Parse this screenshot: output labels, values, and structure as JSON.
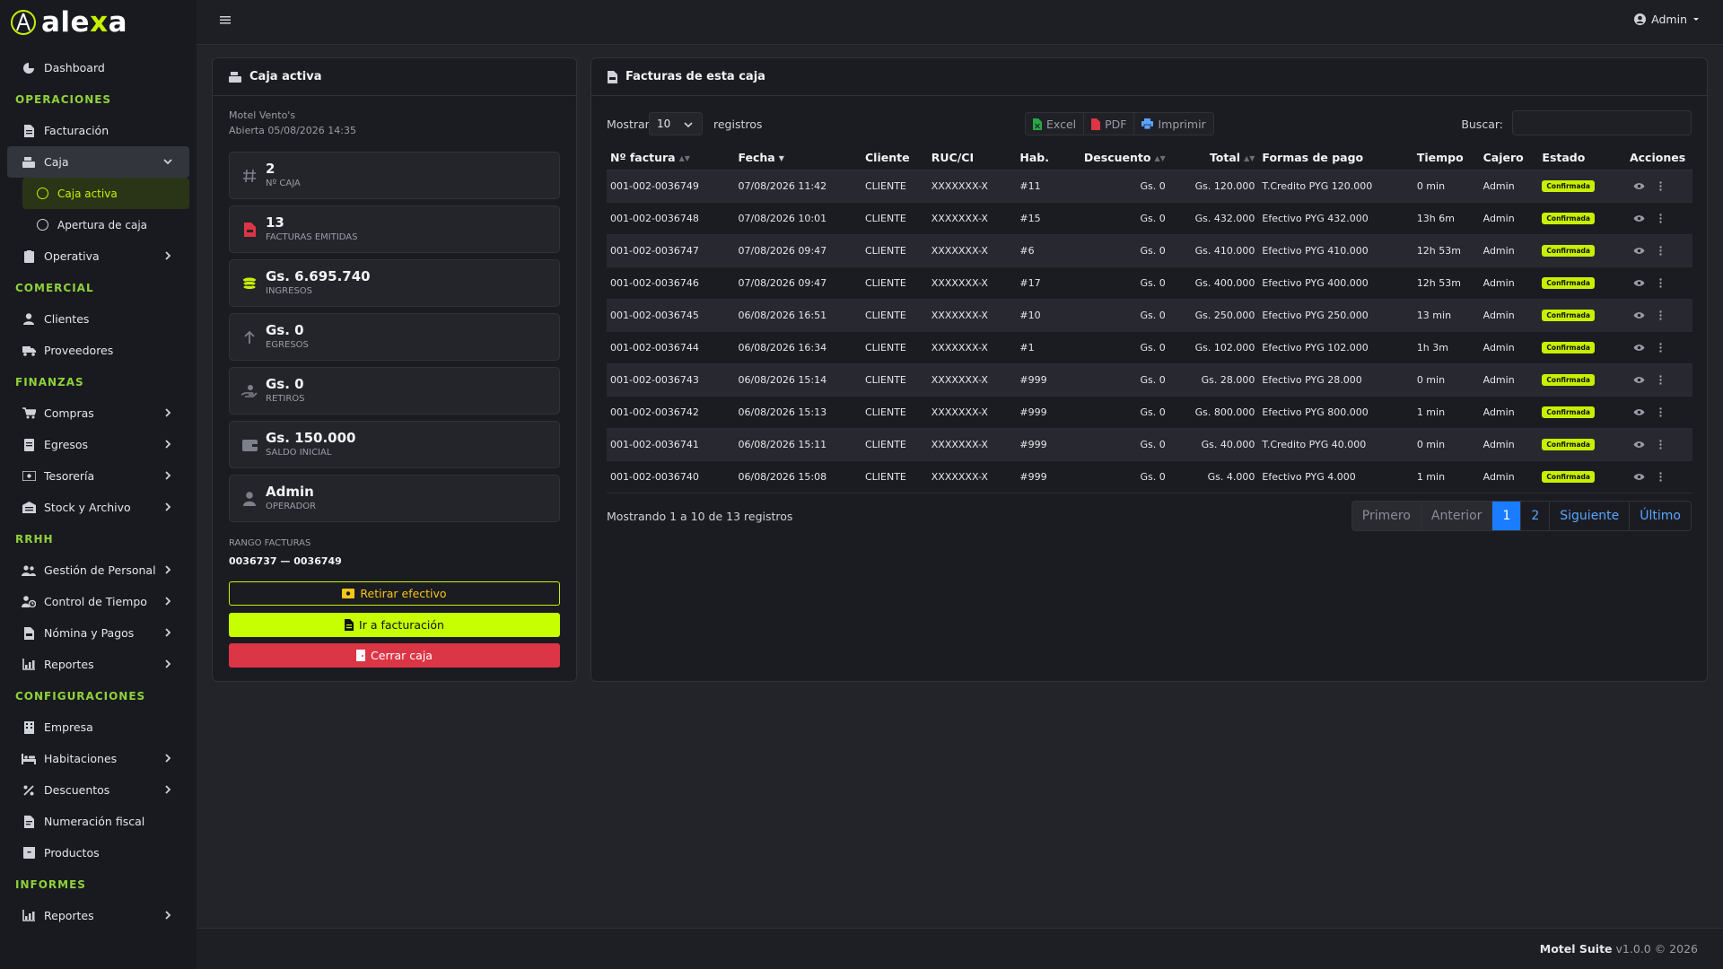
{
  "brand": {
    "name_pre": "ale",
    "name_x": "x",
    "name_post": "a"
  },
  "sidebar": {
    "dashboard": "Dashboard",
    "sections": {
      "operaciones": "OPERACIONES",
      "comercial": "COMERCIAL",
      "finanzas": "FINANZAS",
      "rrhh": "RRHH",
      "configuraciones": "CONFIGURACIONES",
      "informes": "INFORMES"
    },
    "items": {
      "facturacion": "Facturación",
      "caja": "Caja",
      "caja_activa": "Caja activa",
      "apertura_caja": "Apertura de caja",
      "operativa": "Operativa",
      "clientes": "Clientes",
      "proveedores": "Proveedores",
      "compras": "Compras",
      "egresos": "Egresos",
      "tesoreria": "Tesorería",
      "stock": "Stock y Archivo",
      "personal": "Gestión de Personal",
      "tiempo": "Control de Tiempo",
      "nomina": "Nómina y Pagos",
      "reportes_rrhh": "Reportes",
      "empresa": "Empresa",
      "habitaciones": "Habitaciones",
      "descuentos": "Descuentos",
      "numeracion": "Numeración fiscal",
      "productos": "Productos",
      "reportes_informes": "Reportes"
    }
  },
  "topbar": {
    "user": "Admin"
  },
  "caja": {
    "title": "Caja activa",
    "motel": "Motel Vento's",
    "opened": "Abierta 05/08/2026 14:35",
    "stats": {
      "numero": {
        "value": "2",
        "label": "Nº CAJA"
      },
      "facturas": {
        "value": "13",
        "label": "FACTURAS EMITIDAS"
      },
      "ingresos": {
        "value": "Gs. 6.695.740",
        "label": "INGRESOS"
      },
      "egresos": {
        "value": "Gs. 0",
        "label": "EGRESOS"
      },
      "retiros": {
        "value": "Gs. 0",
        "label": "RETIROS"
      },
      "saldo": {
        "value": "Gs. 150.000",
        "label": "SALDO INICIAL"
      },
      "operador": {
        "value": "Admin",
        "label": "OPERADOR"
      }
    },
    "range_label": "RANGO FACTURAS",
    "range_value": "0036737 — 0036749",
    "btn_retirar": "Retirar efectivo",
    "btn_facturacion": "Ir a facturación",
    "btn_cerrar": "Cerrar caja"
  },
  "facturas": {
    "title": "Facturas de esta caja",
    "show_label": "Mostrar",
    "show_value": "10",
    "records_label": "registros",
    "export": {
      "excel": "Excel",
      "pdf": "PDF",
      "print": "Imprimir"
    },
    "search_label": "Buscar:",
    "search_value": "",
    "columns": [
      "Nº factura",
      "Fecha",
      "Cliente",
      "RUC/CI",
      "Hab.",
      "Descuento",
      "Total",
      "Formas de pago",
      "Tiempo",
      "Cajero",
      "Estado",
      "Acciones"
    ],
    "rows": [
      {
        "num": "001-002-0036749",
        "fecha": "07/08/2026 11:42",
        "cliente": "CLIENTE",
        "ruc": "XXXXXXX-X",
        "hab": "#11",
        "desc": "Gs. 0",
        "total": "Gs. 120.000",
        "pago": "T.Credito PYG 120.000",
        "tiempo": "0 min",
        "cajero": "Admin",
        "estado": "Confirmada"
      },
      {
        "num": "001-002-0036748",
        "fecha": "07/08/2026 10:01",
        "cliente": "CLIENTE",
        "ruc": "XXXXXXX-X",
        "hab": "#15",
        "desc": "Gs. 0",
        "total": "Gs. 432.000",
        "pago": "Efectivo PYG 432.000",
        "tiempo": "13h 6m",
        "cajero": "Admin",
        "estado": "Confirmada"
      },
      {
        "num": "001-002-0036747",
        "fecha": "07/08/2026 09:47",
        "cliente": "CLIENTE",
        "ruc": "XXXXXXX-X",
        "hab": "#6",
        "desc": "Gs. 0",
        "total": "Gs. 410.000",
        "pago": "Efectivo PYG 410.000",
        "tiempo": "12h 53m",
        "cajero": "Admin",
        "estado": "Confirmada"
      },
      {
        "num": "001-002-0036746",
        "fecha": "07/08/2026 09:47",
        "cliente": "CLIENTE",
        "ruc": "XXXXXXX-X",
        "hab": "#17",
        "desc": "Gs. 0",
        "total": "Gs. 400.000",
        "pago": "Efectivo PYG 400.000",
        "tiempo": "12h 53m",
        "cajero": "Admin",
        "estado": "Confirmada"
      },
      {
        "num": "001-002-0036745",
        "fecha": "06/08/2026 16:51",
        "cliente": "CLIENTE",
        "ruc": "XXXXXXX-X",
        "hab": "#10",
        "desc": "Gs. 0",
        "total": "Gs. 250.000",
        "pago": "Efectivo PYG 250.000",
        "tiempo": "13 min",
        "cajero": "Admin",
        "estado": "Confirmada"
      },
      {
        "num": "001-002-0036744",
        "fecha": "06/08/2026 16:34",
        "cliente": "CLIENTE",
        "ruc": "XXXXXXX-X",
        "hab": "#1",
        "desc": "Gs. 0",
        "total": "Gs. 102.000",
        "pago": "Efectivo PYG 102.000",
        "tiempo": "1h 3m",
        "cajero": "Admin",
        "estado": "Confirmada"
      },
      {
        "num": "001-002-0036743",
        "fecha": "06/08/2026 15:14",
        "cliente": "CLIENTE",
        "ruc": "XXXXXXX-X",
        "hab": "#999",
        "desc": "Gs. 0",
        "total": "Gs. 28.000",
        "pago": "Efectivo PYG 28.000",
        "tiempo": "0 min",
        "cajero": "Admin",
        "estado": "Confirmada"
      },
      {
        "num": "001-002-0036742",
        "fecha": "06/08/2026 15:13",
        "cliente": "CLIENTE",
        "ruc": "XXXXXXX-X",
        "hab": "#999",
        "desc": "Gs. 0",
        "total": "Gs. 800.000",
        "pago": "Efectivo PYG 800.000",
        "tiempo": "1 min",
        "cajero": "Admin",
        "estado": "Confirmada"
      },
      {
        "num": "001-002-0036741",
        "fecha": "06/08/2026 15:11",
        "cliente": "CLIENTE",
        "ruc": "XXXXXXX-X",
        "hab": "#999",
        "desc": "Gs. 0",
        "total": "Gs. 40.000",
        "pago": "T.Credito PYG 40.000",
        "tiempo": "0 min",
        "cajero": "Admin",
        "estado": "Confirmada"
      },
      {
        "num": "001-002-0036740",
        "fecha": "06/08/2026 15:08",
        "cliente": "CLIENTE",
        "ruc": "XXXXXXX-X",
        "hab": "#999",
        "desc": "Gs. 0",
        "total": "Gs. 4.000",
        "pago": "Efectivo PYG 4.000",
        "tiempo": "1 min",
        "cajero": "Admin",
        "estado": "Confirmada"
      }
    ],
    "info": "Mostrando 1 a 10 de 13 registros",
    "pagination": {
      "first": "Primero",
      "prev": "Anterior",
      "p1": "1",
      "p2": "2",
      "next": "Siguiente",
      "last": "Último"
    }
  },
  "footer": {
    "product": "Motel Suite",
    "version": "v1.0.0 © 2026"
  },
  "colors": {
    "accent": "#c6f000",
    "danger": "#dc3545",
    "link": "#5aa4ff",
    "page_active": "#1a7dff",
    "section_title": "#8fd13b"
  }
}
